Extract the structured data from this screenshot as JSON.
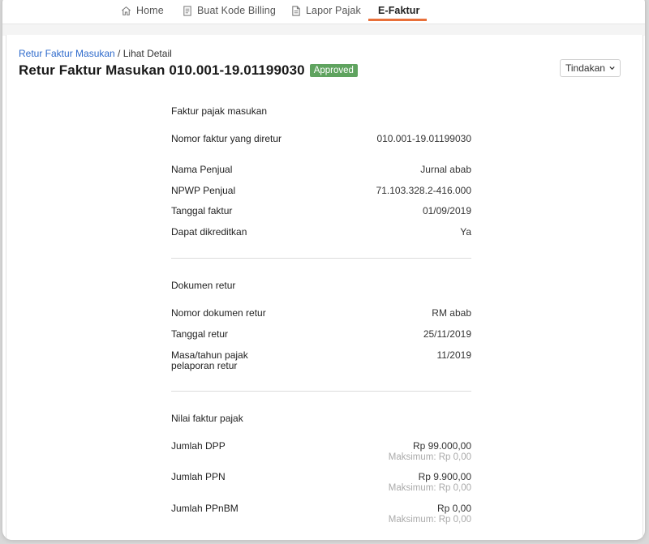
{
  "nav": {
    "items": [
      {
        "label": "Home",
        "icon": "home-icon"
      },
      {
        "label": "Buat Kode Billing",
        "icon": "document-icon"
      },
      {
        "label": "Lapor Pajak",
        "icon": "file-icon"
      },
      {
        "label": "E-Faktur",
        "icon": ""
      }
    ],
    "active": "E-Faktur",
    "accent": "#e8703a"
  },
  "breadcrumb": {
    "link": "Retur Faktur Masukan",
    "separator": " / ",
    "current": "Lihat Detail"
  },
  "page": {
    "title": "Retur Faktur Masukan 010.001-19.01199030",
    "status": "Approved",
    "status_color": "#5fa35f"
  },
  "action_button": {
    "label": "Tindakan"
  },
  "sections": {
    "faktur": {
      "title": "Faktur pajak masukan",
      "rows": [
        {
          "label": "Nomor faktur yang diretur",
          "value": "010.001-19.01199030"
        },
        {
          "label": "Nama Penjual",
          "value": "Jurnal abab"
        },
        {
          "label": "NPWP Penjual",
          "value": "71.103.328.2-416.000"
        },
        {
          "label": "Tanggal faktur",
          "value": "01/09/2019"
        },
        {
          "label": "Dapat dikreditkan",
          "value": "Ya"
        }
      ]
    },
    "dokumen": {
      "title": "Dokumen retur",
      "rows": [
        {
          "label": "Nomor dokumen retur",
          "value": "RM abab"
        },
        {
          "label": "Tanggal retur",
          "value": "25/11/2019"
        },
        {
          "label": "Masa/tahun pajak pelaporan retur",
          "value": "11/2019"
        }
      ]
    },
    "nilai": {
      "title": "Nilai faktur pajak",
      "rows": [
        {
          "label": "Jumlah DPP",
          "value": "Rp 99.000,00",
          "sub": "Maksimum: Rp 0,00"
        },
        {
          "label": "Jumlah PPN",
          "value": "Rp 9.900,00",
          "sub": "Maksimum: Rp 0,00"
        },
        {
          "label": "Jumlah PPnBM",
          "value": "Rp 0,00",
          "sub": "Maksimum: Rp 0,00"
        }
      ]
    }
  }
}
